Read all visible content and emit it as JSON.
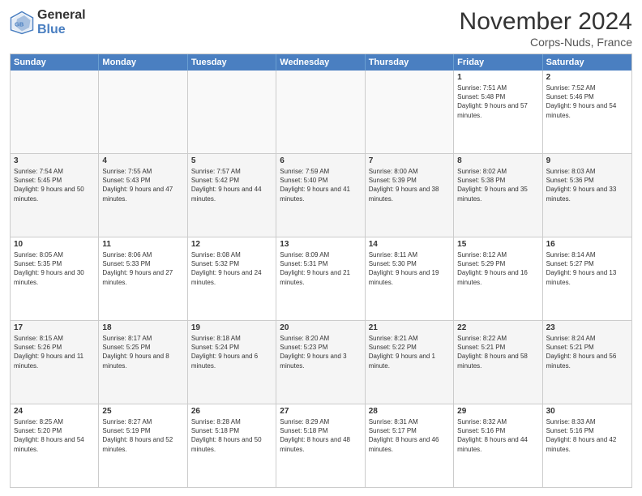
{
  "logo": {
    "general": "General",
    "blue": "Blue"
  },
  "title": "November 2024",
  "location": "Corps-Nuds, France",
  "days_of_week": [
    "Sunday",
    "Monday",
    "Tuesday",
    "Wednesday",
    "Thursday",
    "Friday",
    "Saturday"
  ],
  "weeks": [
    {
      "cells": [
        {
          "day": null,
          "content": ""
        },
        {
          "day": null,
          "content": ""
        },
        {
          "day": null,
          "content": ""
        },
        {
          "day": null,
          "content": ""
        },
        {
          "day": null,
          "content": ""
        },
        {
          "day": "1",
          "content": "Sunrise: 7:51 AM\nSunset: 5:48 PM\nDaylight: 9 hours and 57 minutes."
        },
        {
          "day": "2",
          "content": "Sunrise: 7:52 AM\nSunset: 5:46 PM\nDaylight: 9 hours and 54 minutes."
        }
      ]
    },
    {
      "cells": [
        {
          "day": "3",
          "content": "Sunrise: 7:54 AM\nSunset: 5:45 PM\nDaylight: 9 hours and 50 minutes."
        },
        {
          "day": "4",
          "content": "Sunrise: 7:55 AM\nSunset: 5:43 PM\nDaylight: 9 hours and 47 minutes."
        },
        {
          "day": "5",
          "content": "Sunrise: 7:57 AM\nSunset: 5:42 PM\nDaylight: 9 hours and 44 minutes."
        },
        {
          "day": "6",
          "content": "Sunrise: 7:59 AM\nSunset: 5:40 PM\nDaylight: 9 hours and 41 minutes."
        },
        {
          "day": "7",
          "content": "Sunrise: 8:00 AM\nSunset: 5:39 PM\nDaylight: 9 hours and 38 minutes."
        },
        {
          "day": "8",
          "content": "Sunrise: 8:02 AM\nSunset: 5:38 PM\nDaylight: 9 hours and 35 minutes."
        },
        {
          "day": "9",
          "content": "Sunrise: 8:03 AM\nSunset: 5:36 PM\nDaylight: 9 hours and 33 minutes."
        }
      ]
    },
    {
      "cells": [
        {
          "day": "10",
          "content": "Sunrise: 8:05 AM\nSunset: 5:35 PM\nDaylight: 9 hours and 30 minutes."
        },
        {
          "day": "11",
          "content": "Sunrise: 8:06 AM\nSunset: 5:33 PM\nDaylight: 9 hours and 27 minutes."
        },
        {
          "day": "12",
          "content": "Sunrise: 8:08 AM\nSunset: 5:32 PM\nDaylight: 9 hours and 24 minutes."
        },
        {
          "day": "13",
          "content": "Sunrise: 8:09 AM\nSunset: 5:31 PM\nDaylight: 9 hours and 21 minutes."
        },
        {
          "day": "14",
          "content": "Sunrise: 8:11 AM\nSunset: 5:30 PM\nDaylight: 9 hours and 19 minutes."
        },
        {
          "day": "15",
          "content": "Sunrise: 8:12 AM\nSunset: 5:29 PM\nDaylight: 9 hours and 16 minutes."
        },
        {
          "day": "16",
          "content": "Sunrise: 8:14 AM\nSunset: 5:27 PM\nDaylight: 9 hours and 13 minutes."
        }
      ]
    },
    {
      "cells": [
        {
          "day": "17",
          "content": "Sunrise: 8:15 AM\nSunset: 5:26 PM\nDaylight: 9 hours and 11 minutes."
        },
        {
          "day": "18",
          "content": "Sunrise: 8:17 AM\nSunset: 5:25 PM\nDaylight: 9 hours and 8 minutes."
        },
        {
          "day": "19",
          "content": "Sunrise: 8:18 AM\nSunset: 5:24 PM\nDaylight: 9 hours and 6 minutes."
        },
        {
          "day": "20",
          "content": "Sunrise: 8:20 AM\nSunset: 5:23 PM\nDaylight: 9 hours and 3 minutes."
        },
        {
          "day": "21",
          "content": "Sunrise: 8:21 AM\nSunset: 5:22 PM\nDaylight: 9 hours and 1 minute."
        },
        {
          "day": "22",
          "content": "Sunrise: 8:22 AM\nSunset: 5:21 PM\nDaylight: 8 hours and 58 minutes."
        },
        {
          "day": "23",
          "content": "Sunrise: 8:24 AM\nSunset: 5:21 PM\nDaylight: 8 hours and 56 minutes."
        }
      ]
    },
    {
      "cells": [
        {
          "day": "24",
          "content": "Sunrise: 8:25 AM\nSunset: 5:20 PM\nDaylight: 8 hours and 54 minutes."
        },
        {
          "day": "25",
          "content": "Sunrise: 8:27 AM\nSunset: 5:19 PM\nDaylight: 8 hours and 52 minutes."
        },
        {
          "day": "26",
          "content": "Sunrise: 8:28 AM\nSunset: 5:18 PM\nDaylight: 8 hours and 50 minutes."
        },
        {
          "day": "27",
          "content": "Sunrise: 8:29 AM\nSunset: 5:18 PM\nDaylight: 8 hours and 48 minutes."
        },
        {
          "day": "28",
          "content": "Sunrise: 8:31 AM\nSunset: 5:17 PM\nDaylight: 8 hours and 46 minutes."
        },
        {
          "day": "29",
          "content": "Sunrise: 8:32 AM\nSunset: 5:16 PM\nDaylight: 8 hours and 44 minutes."
        },
        {
          "day": "30",
          "content": "Sunrise: 8:33 AM\nSunset: 5:16 PM\nDaylight: 8 hours and 42 minutes."
        }
      ]
    }
  ]
}
